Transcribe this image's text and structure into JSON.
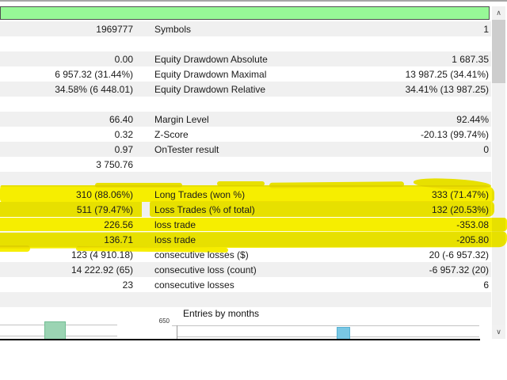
{
  "colors": {
    "row_alt_bg": "#f0f0f0",
    "highlight_yellow": "#f6ee00",
    "progress_green": "#97f897",
    "progress_border": "#4f4f4f",
    "bar_green_fill": "#9bd4b3",
    "bar_green_border": "#72bd93",
    "bar_blue_fill": "#79c7e4",
    "bar_blue_border": "#55b0d2",
    "gridline": "#c3c3c3",
    "text": "#1a1a1a"
  },
  "stats_rows": [
    {
      "left": "1969777",
      "label": "Symbols",
      "right": "1"
    },
    {
      "left": "",
      "label": "",
      "right": ""
    },
    {
      "left": "0.00",
      "label": "Equity Drawdown Absolute",
      "right": "1 687.35"
    },
    {
      "left": "6 957.32 (31.44%)",
      "label": "Equity Drawdown Maximal",
      "right": "13 987.25 (34.41%)"
    },
    {
      "left": "34.58% (6 448.01)",
      "label": "Equity Drawdown Relative",
      "right": "34.41% (13 987.25)"
    },
    {
      "left": "",
      "label": "",
      "right": ""
    },
    {
      "left": "66.40",
      "label": "Margin Level",
      "right": "92.44%"
    },
    {
      "left": "0.32",
      "label": "Z-Score",
      "right": "-20.13 (99.74%)"
    },
    {
      "left": "0.97",
      "label": "OnTester result",
      "right": "0"
    },
    {
      "left": "3 750.76",
      "label": "",
      "right": ""
    },
    {
      "left": "",
      "label": "",
      "right": ""
    },
    {
      "left": "310 (88.06%)",
      "label": "Long Trades (won %)",
      "right": "333 (71.47%)"
    },
    {
      "left": "511 (79.47%)",
      "label": "Loss Trades (% of total)",
      "right": "132 (20.53%)"
    },
    {
      "left": "226.56",
      "label": "loss trade",
      "right": "-353.08"
    },
    {
      "left": "136.71",
      "label": "loss trade",
      "right": "-205.80"
    },
    {
      "left": "123 (4 910.18)",
      "label": "consecutive losses ($)",
      "right": "20 (-6 957.32)"
    },
    {
      "left": "14 222.92 (65)",
      "label": "consecutive loss (count)",
      "right": "-6 957.32 (20)"
    },
    {
      "left": "23",
      "label": "consecutive losses",
      "right": "6"
    },
    {
      "left": "",
      "label": "",
      "right": ""
    }
  ],
  "chart_data": [
    {
      "type": "bar",
      "title": "",
      "bars_visible": 1,
      "bar_color": "#9bd4b3"
    },
    {
      "type": "bar",
      "title": "Entries by months",
      "ytick_label": "650",
      "bars_visible": 1,
      "bar_color": "#79c7e4"
    }
  ],
  "scrollbar": {
    "up_glyph": "∧",
    "down_glyph": "∨"
  }
}
